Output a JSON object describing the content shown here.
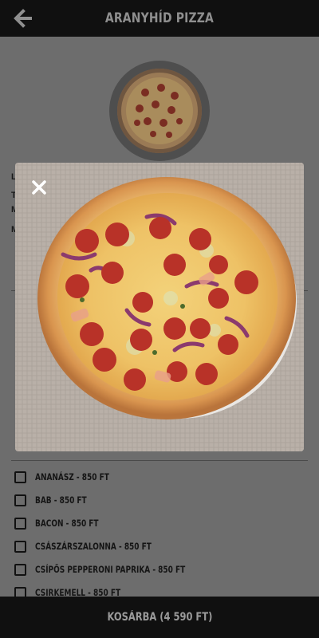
{
  "header": {
    "title": "ARANYHÍD PIZZA",
    "back_icon": "arrow-left-icon"
  },
  "product": {
    "thumbnail_icon": "pizza-image",
    "description_fragments": [
      "L",
      "T",
      "M",
      "M"
    ]
  },
  "image_viewer": {
    "close_icon": "close-icon",
    "image_icon": "pizza-image"
  },
  "extras": [
    {
      "label": "ANANÁSZ - 850 FT",
      "checked": false
    },
    {
      "label": "BAB - 850 FT",
      "checked": false
    },
    {
      "label": "BACON - 850 FT",
      "checked": false
    },
    {
      "label": "CSÁSZÁRSZALONNA - 850 FT",
      "checked": false
    },
    {
      "label": "CSÍPŐS PEPPERONI PAPRIKA - 850 FT",
      "checked": false
    },
    {
      "label": "CSIRKEMELL - 850 FT",
      "checked": false
    }
  ],
  "footer": {
    "cart_label": "KOSÁRBA (4 590 FT)"
  }
}
